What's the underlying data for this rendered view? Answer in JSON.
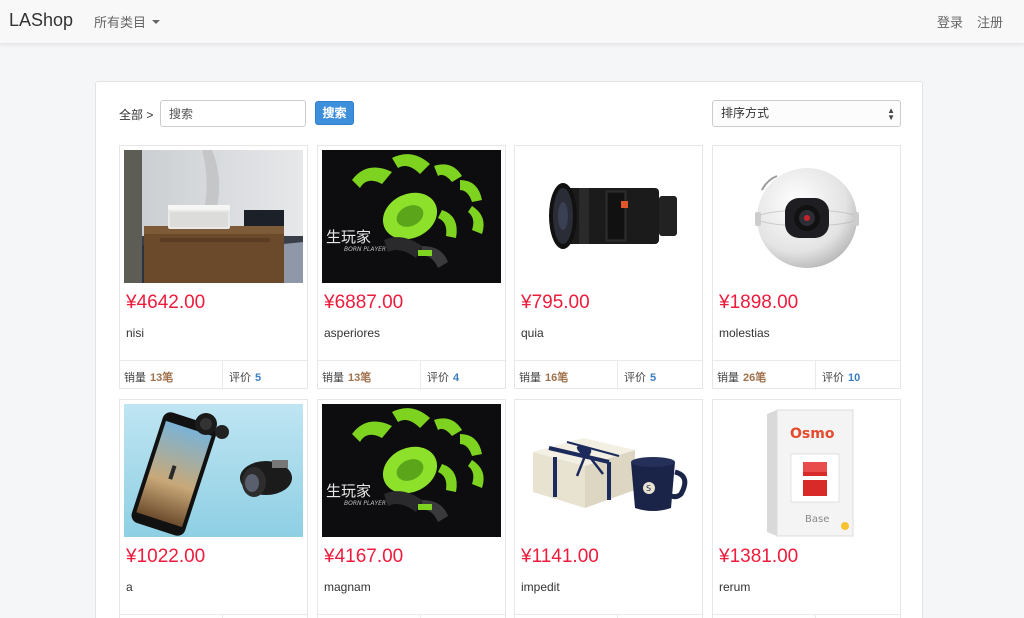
{
  "navbar": {
    "brand": "LAShop",
    "category_menu": "所有类目",
    "login": "登录",
    "register": "注册"
  },
  "filter": {
    "breadcrumb": "全部 >",
    "search_placeholder": "搜索",
    "search_button": "搜索",
    "sort_label": "排序方式"
  },
  "stats_labels": {
    "sales": "销量",
    "reviews": "评价"
  },
  "products": [
    {
      "price": "¥4642.00",
      "title": "nisi",
      "sales": "13笔",
      "reviews": "5",
      "image": "speaker-photo"
    },
    {
      "price": "¥6887.00",
      "title": "asperiores",
      "sales": "13笔",
      "reviews": "4",
      "image": "green-mouse-photo"
    },
    {
      "price": "¥795.00",
      "title": "quia",
      "sales": "16笔",
      "reviews": "5",
      "image": "camera-lens-photo"
    },
    {
      "price": "¥1898.00",
      "title": "molestias",
      "sales": "26笔",
      "reviews": "10",
      "image": "360-camera-photo"
    },
    {
      "price": "¥1022.00",
      "title": "a",
      "sales": "",
      "reviews": "",
      "image": "phone-lens-photo"
    },
    {
      "price": "¥4167.00",
      "title": "magnam",
      "sales": "",
      "reviews": "",
      "image": "green-mouse-photo"
    },
    {
      "price": "¥1141.00",
      "title": "impedit",
      "sales": "",
      "reviews": "",
      "image": "gift-mug-photo"
    },
    {
      "price": "¥1381.00",
      "title": "rerum",
      "sales": "",
      "reviews": "",
      "image": "osmo-box-photo"
    }
  ],
  "image_text": {
    "osmo_brand": "Osmo",
    "osmo_base": "Base",
    "mouse_text_cn": "生玩家",
    "mouse_text_en": "BORN PLAYER"
  },
  "colors": {
    "price": "#ee1c3c",
    "search_button": "#3d8edb",
    "sales_value": "#a0714b",
    "review_value": "#3a7dbf"
  }
}
